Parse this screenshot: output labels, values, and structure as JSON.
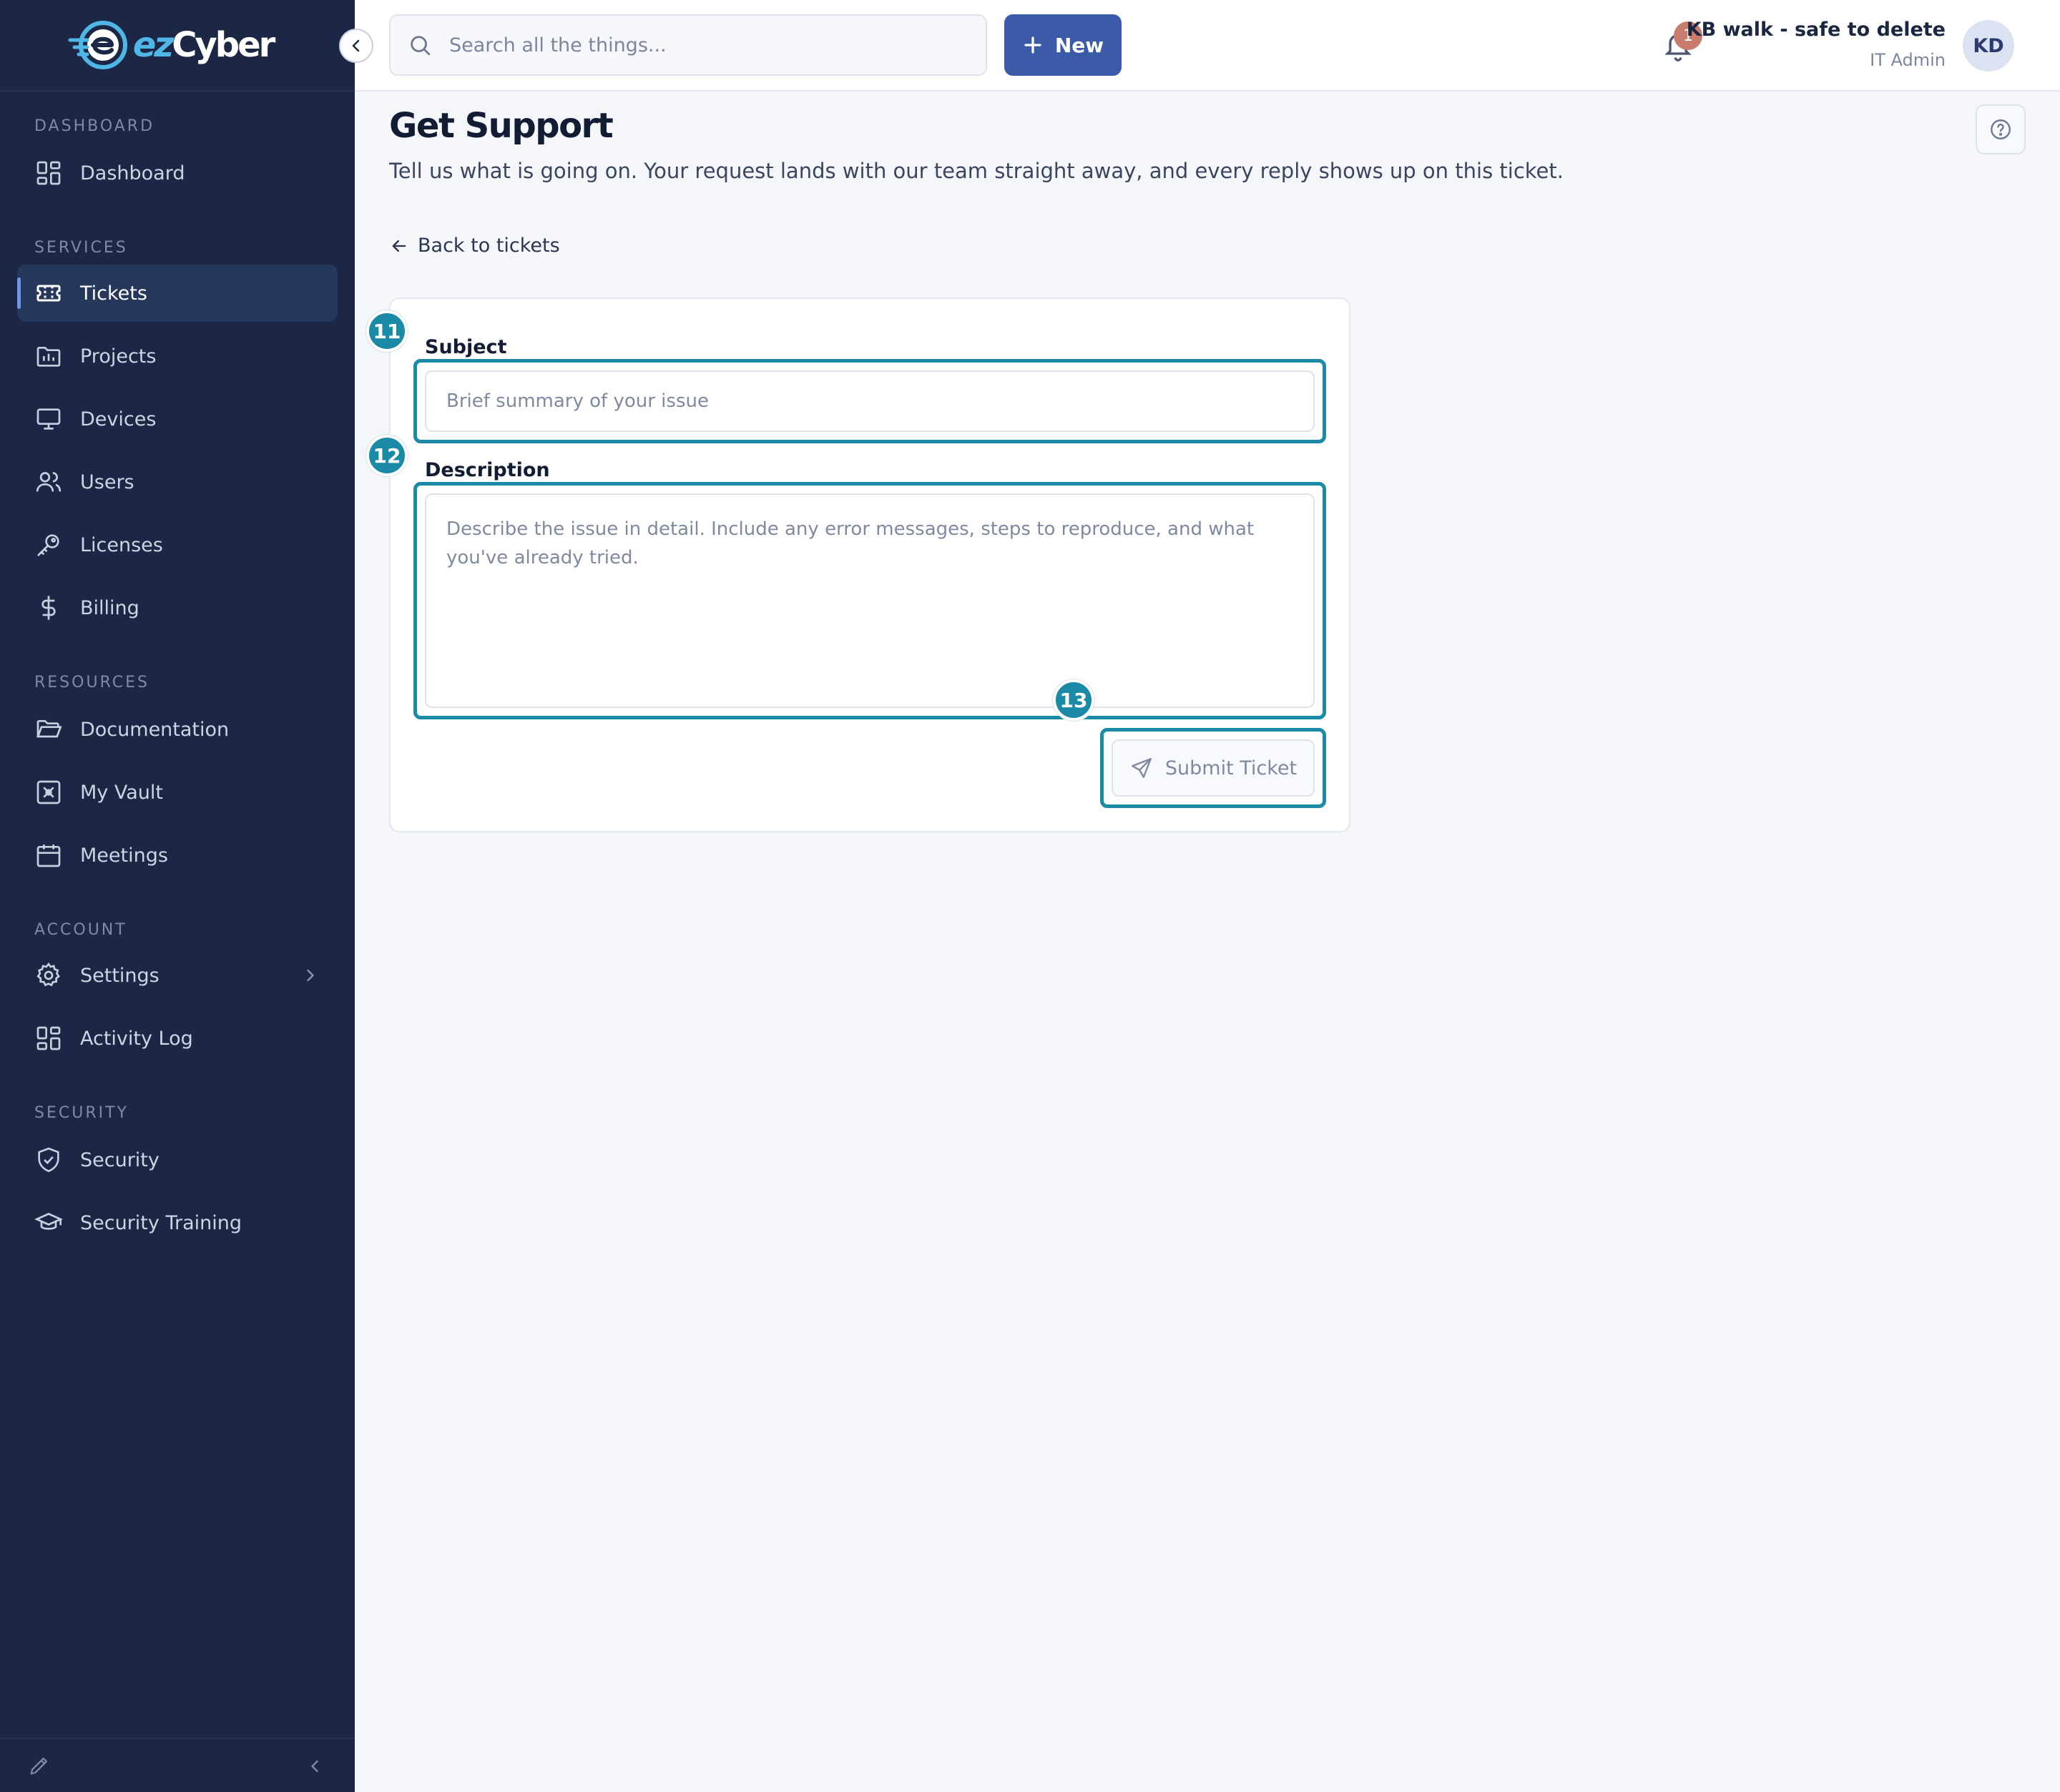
{
  "brand": {
    "prefix": "ez",
    "name": "Cyber"
  },
  "sidebar": {
    "sections": [
      {
        "label": "DASHBOARD"
      },
      {
        "label": "SERVICES"
      },
      {
        "label": "RESOURCES"
      },
      {
        "label": "ACCOUNT"
      },
      {
        "label": "SECURITY"
      }
    ],
    "items": [
      {
        "label": "Dashboard",
        "icon": "grid-icon"
      },
      {
        "label": "Tickets",
        "icon": "ticket-icon",
        "active": true
      },
      {
        "label": "Projects",
        "icon": "folder-chart-icon"
      },
      {
        "label": "Devices",
        "icon": "monitor-icon"
      },
      {
        "label": "Users",
        "icon": "users-icon"
      },
      {
        "label": "Licenses",
        "icon": "key-icon"
      },
      {
        "label": "Billing",
        "icon": "dollar-icon"
      },
      {
        "label": "Documentation",
        "icon": "folder-open-icon"
      },
      {
        "label": "My Vault",
        "icon": "vault-icon"
      },
      {
        "label": "Meetings",
        "icon": "calendar-icon"
      },
      {
        "label": "Settings",
        "icon": "gear-icon"
      },
      {
        "label": "Activity Log",
        "icon": "grid-icon"
      },
      {
        "label": "Security",
        "icon": "shield-icon"
      },
      {
        "label": "Security Training",
        "icon": "graduation-cap-icon"
      }
    ]
  },
  "topbar": {
    "search_placeholder": "Search all the things...",
    "new_label": "New",
    "notification_count": "1",
    "user_name": "KB walk - safe to delete",
    "user_role": "IT Admin",
    "avatar_initials": "KD"
  },
  "page": {
    "title": "Get Support",
    "subtitle": "Tell us what is going on. Your request lands with our team straight away, and every reply shows up on this ticket.",
    "back_label": "Back to tickets"
  },
  "form": {
    "subject_label": "Subject",
    "subject_placeholder": "Brief summary of your issue",
    "subject_value": "",
    "description_label": "Description",
    "description_placeholder": "Describe the issue in detail. Include any error messages, steps to reproduce, and what you've already tried.",
    "description_value": "",
    "submit_label": "Submit Ticket"
  },
  "annotations": [
    "11",
    "12",
    "13"
  ],
  "colors": {
    "sidebar_bg": "#1b2745",
    "accent": "#3b5ba8",
    "highlight": "#1a8aa6",
    "badge": "#c97b6e"
  }
}
